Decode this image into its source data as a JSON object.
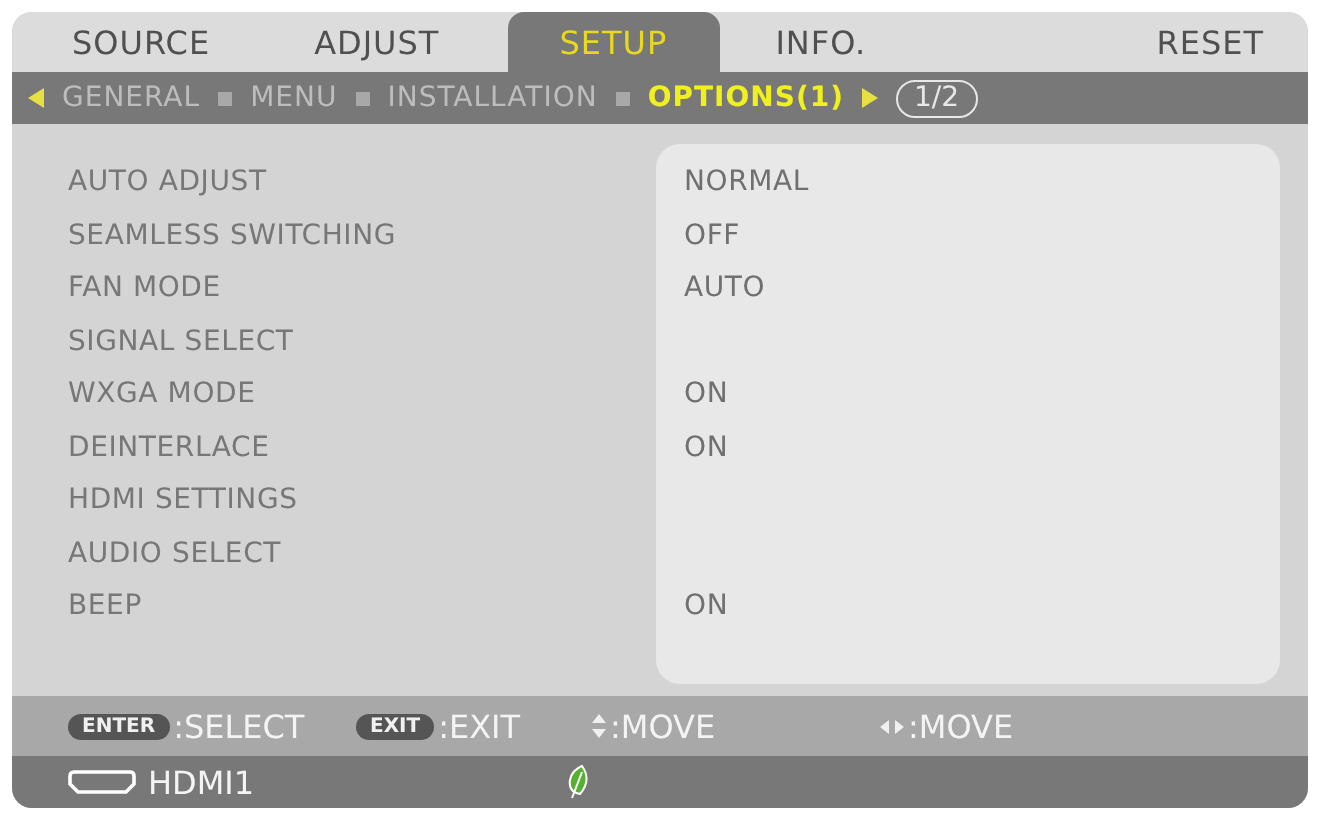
{
  "tabs": [
    {
      "label": "SOURCE",
      "selected": false
    },
    {
      "label": "ADJUST",
      "selected": false
    },
    {
      "label": "SETUP",
      "selected": true
    },
    {
      "label": "INFO.",
      "selected": false
    },
    {
      "label": "RESET",
      "selected": false
    }
  ],
  "subtabs": [
    {
      "label": "GENERAL",
      "selected": false
    },
    {
      "label": "MENU",
      "selected": false
    },
    {
      "label": "INSTALLATION",
      "selected": false
    },
    {
      "label": "OPTIONS(1)",
      "selected": true
    }
  ],
  "page": "1/2",
  "settings": [
    {
      "label": "AUTO ADJUST",
      "value": "NORMAL"
    },
    {
      "label": "SEAMLESS SWITCHING",
      "value": "OFF"
    },
    {
      "label": "FAN MODE",
      "value": "AUTO"
    },
    {
      "label": "SIGNAL SELECT"
    },
    {
      "label": "WXGA MODE",
      "value": "ON"
    },
    {
      "label": "DEINTERLACE",
      "value": "ON"
    },
    {
      "label": "HDMI SETTINGS"
    },
    {
      "label": "AUDIO SELECT"
    },
    {
      "label": "BEEP",
      "value": "ON"
    }
  ],
  "help": [
    {
      "kind": "key",
      "key": "ENTER",
      "label": ":SELECT"
    },
    {
      "kind": "key",
      "key": "EXIT",
      "label": ":EXIT"
    },
    {
      "kind": "updown",
      "label": ":MOVE"
    },
    {
      "kind": "leftright",
      "label": ":MOVE"
    }
  ],
  "status": {
    "source": "HDMI1"
  }
}
